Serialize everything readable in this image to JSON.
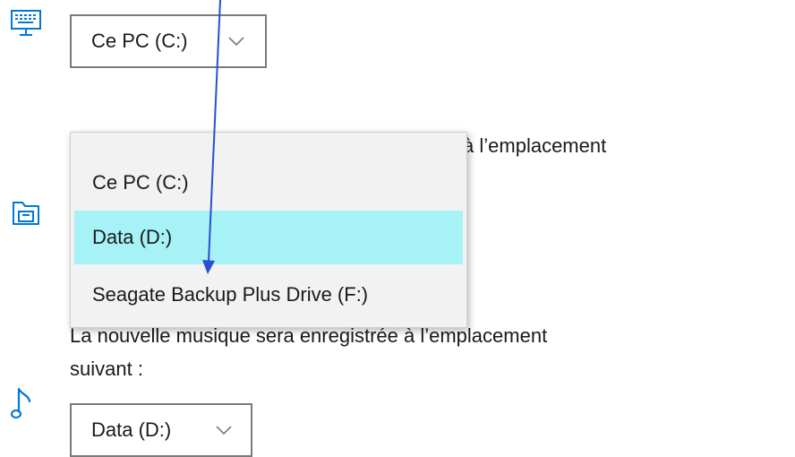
{
  "pictures": {
    "drive_combo": {
      "value": "Ce PC (C:)"
    }
  },
  "documents": {
    "text_line1": "Les nouveaux documents seront enregistrés à l’emplacement",
    "text_line1_visible": "enregistrés à l’emplacement"
  },
  "dropdown": {
    "options": [
      "Ce PC (C:)",
      "Data (D:)",
      "Seagate Backup Plus Drive (F:)"
    ],
    "selected_index": 1
  },
  "music": {
    "text_line1": "La nouvelle musique sera enregistrée à l’emplacement",
    "text_line2": "suivant :",
    "drive_combo": {
      "value": "Data (D:)"
    }
  },
  "icons": {
    "pc": "monitor-keyboard-icon",
    "documents": "folder-drive-icon",
    "music": "music-note-icon",
    "chevron": "chevron-down-icon"
  },
  "colors": {
    "accent": "#0078d7",
    "selected_option_bg": "#a6f2f7",
    "arrow": "#2a4fd0"
  }
}
